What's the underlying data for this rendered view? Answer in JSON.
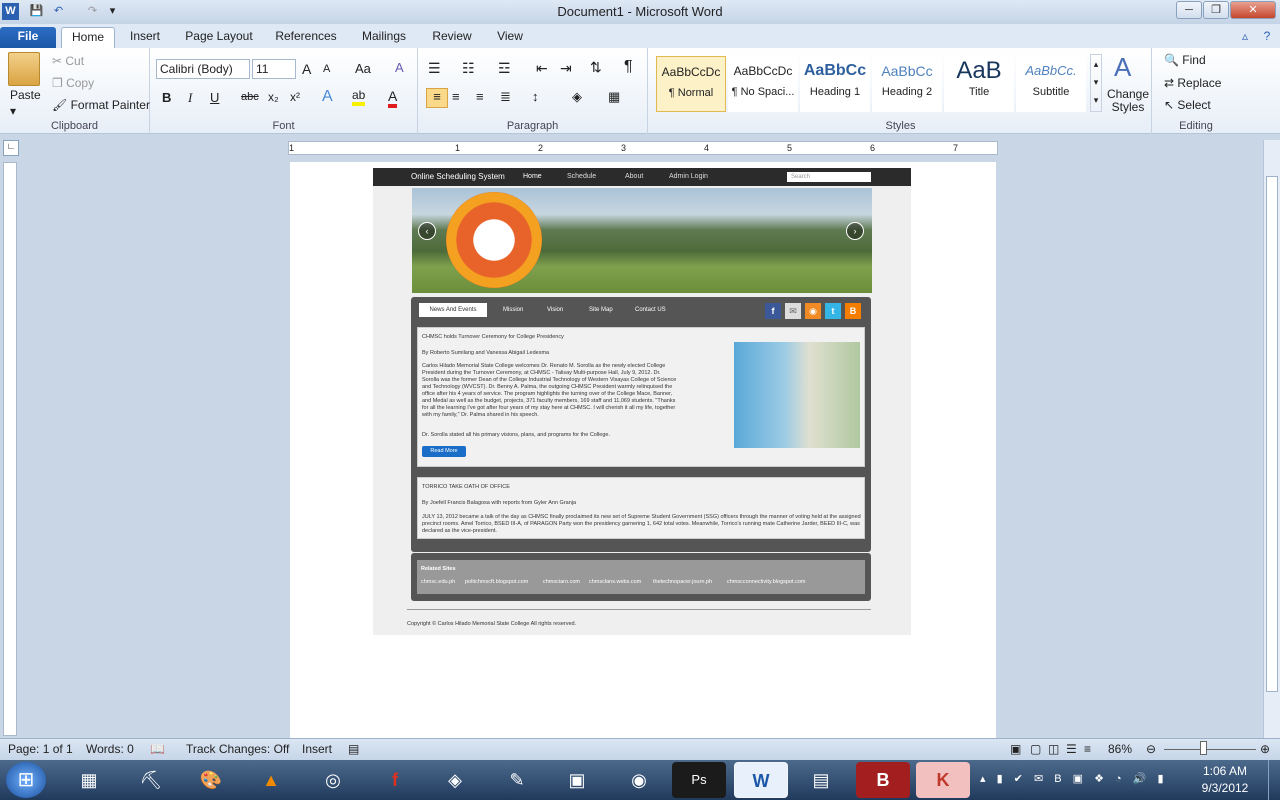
{
  "window": {
    "title": "Document1  -  Microsoft Word",
    "min": "─",
    "max": "❐",
    "close": "✕"
  },
  "qat": {
    "save": "💾",
    "undo": "↶",
    "redo": "↷",
    "more": "▾"
  },
  "tabs": [
    "File",
    "Home",
    "Insert",
    "Page Layout",
    "References",
    "Mailings",
    "Review",
    "View"
  ],
  "clipboard": {
    "paste": "Paste",
    "cut": "Cut",
    "copy": "Copy",
    "format_painter": "Format Painter",
    "label": "Clipboard"
  },
  "font": {
    "name": "Calibri (Body)",
    "size": "11",
    "label": "Font",
    "bold": "B",
    "italic": "I",
    "underline": "U",
    "strike": "abc",
    "sub": "x₂",
    "sup": "x²",
    "grow": "A",
    "shrink": "A",
    "case": "Aa",
    "clear": "A",
    "effects": "A",
    "highlight": "ab",
    "color": "A"
  },
  "paragraph": {
    "label": "Paragraph",
    "pilcrow": "¶"
  },
  "styles": {
    "label": "Styles",
    "items": [
      {
        "preview": "AaBbCcDc",
        "label": "¶ Normal"
      },
      {
        "preview": "AaBbCcDc",
        "label": "¶ No Spaci..."
      },
      {
        "preview": "AaBbCc",
        "label": "Heading 1"
      },
      {
        "preview": "AaBbCc",
        "label": "Heading 2"
      },
      {
        "preview": "AaB",
        "label": "Title"
      },
      {
        "preview": "AaBbCc.",
        "label": "Subtitle"
      }
    ],
    "change": "Change Styles"
  },
  "editing": {
    "label": "Editing",
    "find": "Find",
    "replace": "Replace",
    "select": "Select"
  },
  "ruler": {
    "nums": [
      "1",
      "1",
      "2",
      "3",
      "4",
      "5",
      "6",
      "7"
    ]
  },
  "site": {
    "nav": {
      "brand": "Online Scheduling System",
      "home": "Home",
      "schedule": "Schedule",
      "about": "About",
      "admin": "Admin Login",
      "search": "Search"
    },
    "tabs": [
      "News And Events",
      "Mission",
      "Vision",
      "Site Map",
      "Contact US"
    ],
    "social": [
      "f",
      "✉",
      "◉",
      "t",
      "B"
    ],
    "news1": {
      "title": "CHMSC holds Turnover Ceremony for College Presidency",
      "byline": "By Roberto Sumilang and Vanessa Abigail Ledesma",
      "body": "Carlos Hilado Memorial State College welcomes Dr. Renato M. Sorolla as the newly elected College President during the Turnover Ceremony, at CHMSC - Talisay Multi-purpose Hall, July 9, 2012. Dr. Sorolla was the former Dean of the College Industrial Technology of Western Visayas College of Science and Technology (WVCST). Dr. Benny A. Palma, the outgoing CHMSC President warmly relinquised the office after his 4 years of service. The program highlights the turning over of the College Mace, Banner, and Medal as well as the budget, projects, 371 faculty members, 169 staff and 11,069 students. \"Thanks for all the learning I've got after four years of my stay here at CHMSC. I will cherish it all my life, together with my family,\" Dr. Palma shared in his speech.",
      "body2": "Dr. Sorolla stated all his primary visions, plans, and programs for the College.",
      "button": "Read More"
    },
    "news2": {
      "title": "TORRICO TAKE OATH OF OFFICE",
      "byline": "By Joefell Francis Balagosa with reports from Gyler Ann Granja",
      "body": "JULY 13, 2012 became a talk of the day as CHMSC finally proclaimed its new set of Supreme Student Government (SSG) officers through the manner of voting held at the assigned precinct rooms. Amel Torrico, BSED III-A, of PARAGON Party won the presidency garnering 1, 642 total votes. Meanwhile, Torrico's running mate Catherine Jarder, BEED III-C, was declared as the vice-president."
    },
    "related": {
      "title": "Related Sites",
      "links": [
        "chmsc.edu.ph",
        "politchmscft.blogspot.com",
        "chmsciaro.com",
        "chmsclans.webs.com",
        "thetechnopacer.journ.ph",
        "chmscconnectivity.blogspot.com"
      ]
    },
    "footer": "Copyright © Carlos Hilado Memorial State College All rights reserved."
  },
  "status": {
    "page": "Page: 1 of 1",
    "words": "Words: 0",
    "track": "Track Changes: Off",
    "insert": "Insert",
    "zoom": "86%"
  },
  "taskbar": {
    "time": "1:06 AM",
    "date": "9/3/2012",
    "start": "⊞",
    "apps": [
      "▦",
      "⛏",
      "🎨",
      "▲",
      "◎",
      "f",
      "◈",
      "✎",
      "▣",
      "◉",
      "Ps",
      "W",
      "▤",
      "B",
      "K"
    ]
  }
}
